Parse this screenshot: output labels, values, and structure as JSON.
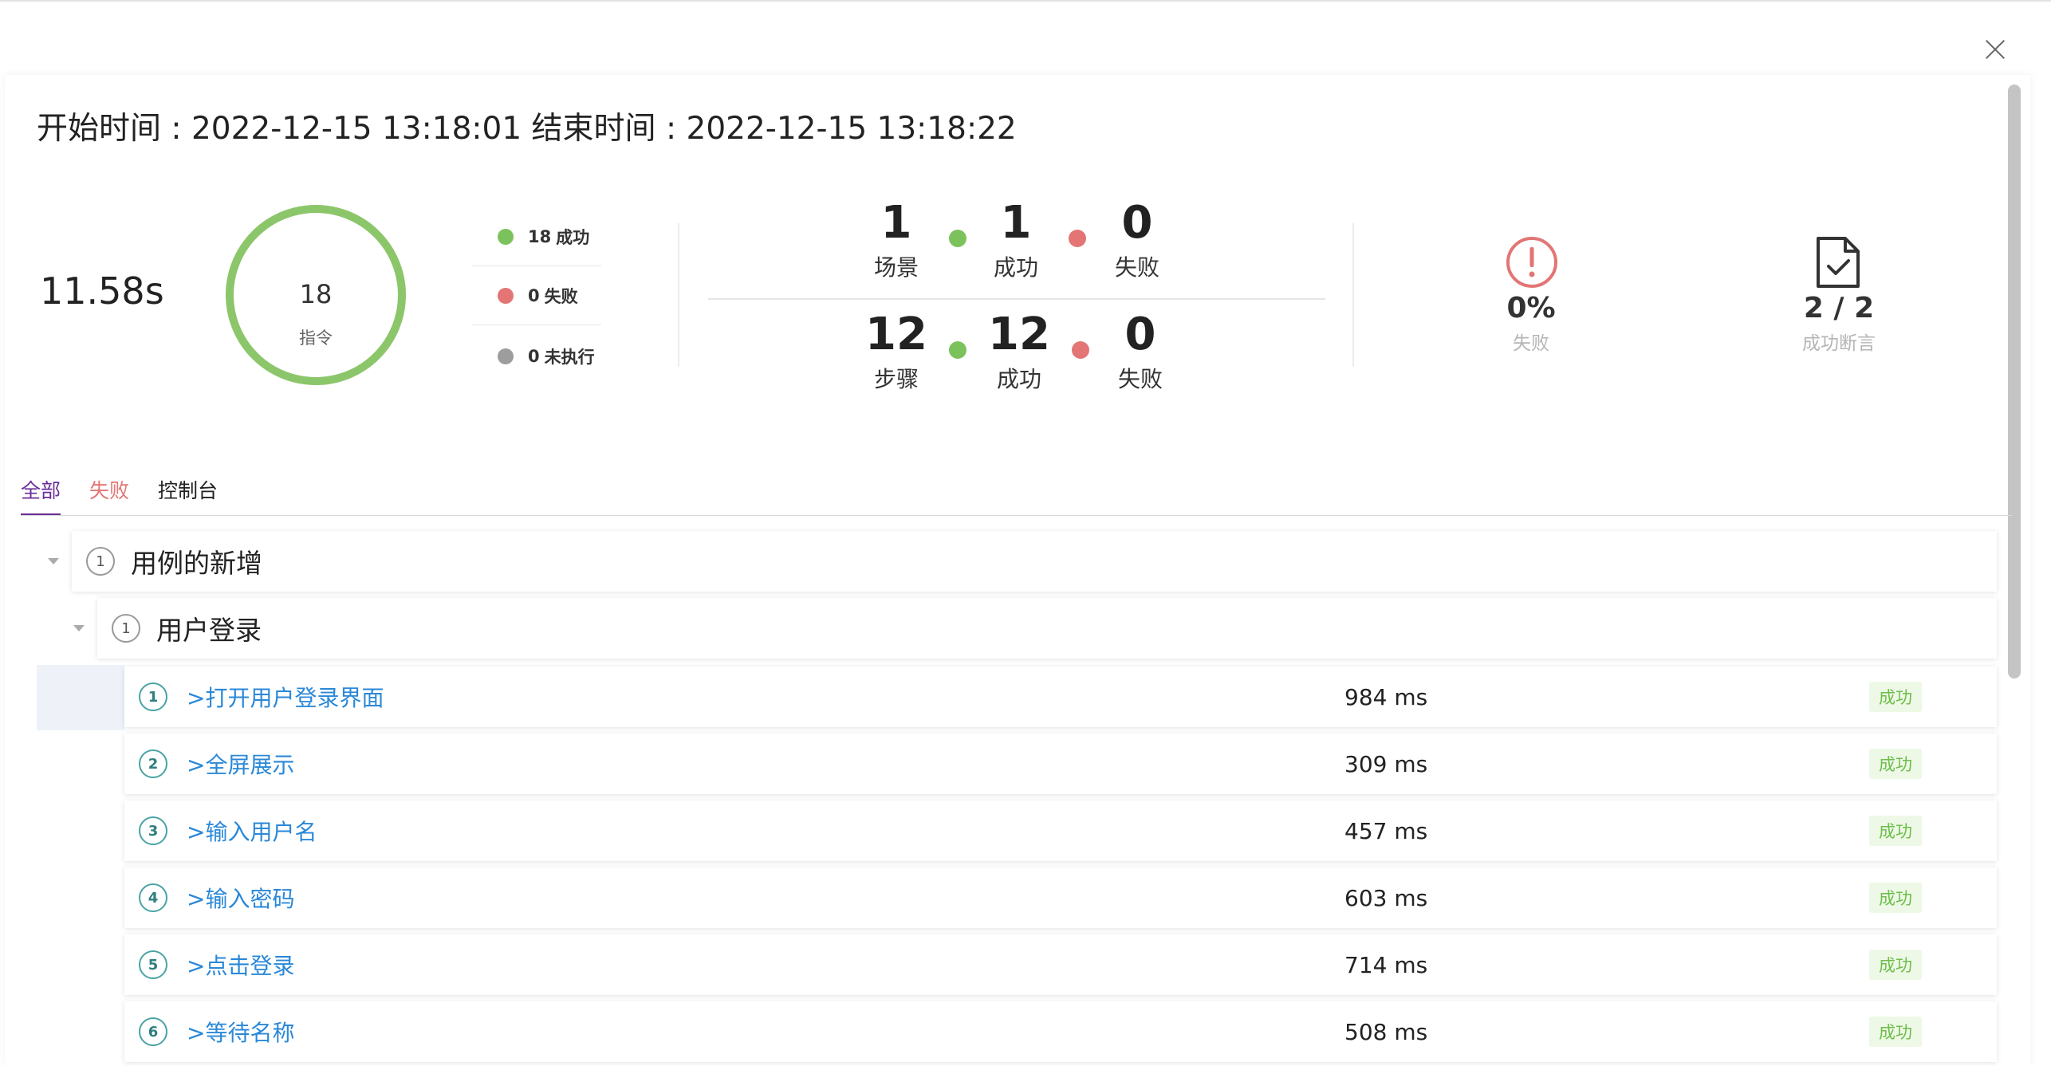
{
  "header": {
    "start_label": "开始时间 : ",
    "start_time": "2022-12-15 13:18:01",
    "end_label": " 结束时间 : ",
    "end_time": "2022-12-15 13:18:22"
  },
  "summary": {
    "total_time": "11.58s",
    "ring_count": "18",
    "ring_label": "指令",
    "ring_success_fraction": 1.0,
    "legend": [
      {
        "count": "18",
        "label": "成功",
        "color": "#7cc25c"
      },
      {
        "count": "0",
        "label": "失败",
        "color": "#e37575"
      },
      {
        "count": "0",
        "label": "未执行",
        "color": "#9d9d9d"
      }
    ]
  },
  "scenarios": {
    "total": "1",
    "total_label": "场景",
    "success": "1",
    "success_label": "成功",
    "fail": "0",
    "fail_label": "失败"
  },
  "steps": {
    "total": "12",
    "total_label": "步骤",
    "success": "12",
    "success_label": "成功",
    "fail": "0",
    "fail_label": "失败"
  },
  "kpis": {
    "fail_rate": "0%",
    "fail_rate_label": "失败",
    "assert": "2 / 2",
    "assert_label": "成功断言"
  },
  "tabs": [
    {
      "label": "全部"
    },
    {
      "label": "失败"
    },
    {
      "label": "控制台"
    }
  ],
  "tree": {
    "case": {
      "index": "1",
      "title": "用例的新增"
    },
    "scenario": {
      "index": "1",
      "title": "用户登录"
    },
    "items": [
      {
        "index": "1",
        "title": ">打开用户登录界面",
        "time": "984 ms",
        "status": "成功"
      },
      {
        "index": "2",
        "title": ">全屏展示",
        "time": "309 ms",
        "status": "成功"
      },
      {
        "index": "3",
        "title": ">输入用户名",
        "time": "457 ms",
        "status": "成功"
      },
      {
        "index": "4",
        "title": ">输入密码",
        "time": "603 ms",
        "status": "成功"
      },
      {
        "index": "5",
        "title": ">点击登录",
        "time": "714 ms",
        "status": "成功"
      },
      {
        "index": "6",
        "title": ">等待名称",
        "time": "508 ms",
        "status": "成功"
      }
    ]
  },
  "colors": {
    "success": "#7cc25c",
    "fail": "#e37575",
    "accent": "#6a2e9a",
    "link": "#2a88d8"
  }
}
